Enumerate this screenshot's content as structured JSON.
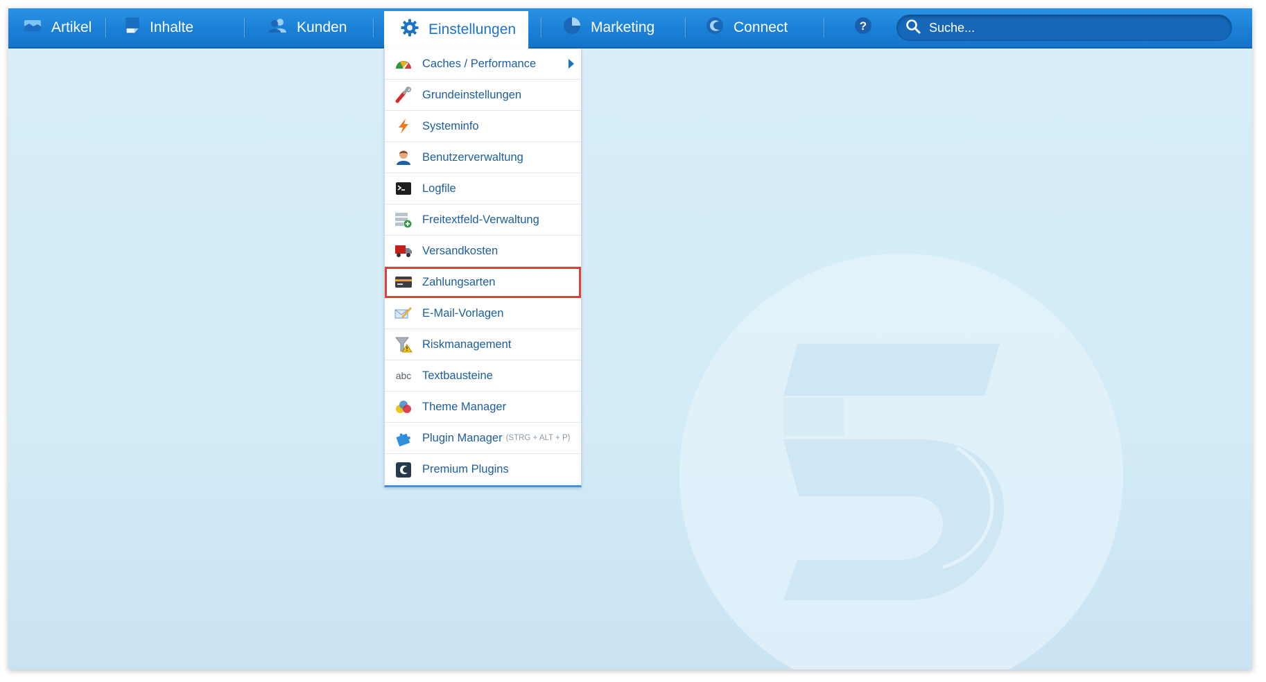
{
  "nav": {
    "items": [
      {
        "label": "Artikel",
        "icon": "articles-icon"
      },
      {
        "label": "Inhalte",
        "icon": "content-icon"
      },
      {
        "label": "Kunden",
        "icon": "customers-icon"
      },
      {
        "label": "Einstellungen",
        "icon": "gear-icon",
        "active": true
      },
      {
        "label": "Marketing",
        "icon": "pie-chart-icon"
      },
      {
        "label": "Connect",
        "icon": "shopware-logo-icon"
      }
    ],
    "help_icon": "help-icon",
    "search": {
      "placeholder": "Suche...",
      "value": "",
      "icon": "search-icon"
    }
  },
  "menu": {
    "items": [
      {
        "label": "Caches / Performance",
        "icon": "speedometer-icon",
        "has_submenu": true
      },
      {
        "label": "Grundeinstellungen",
        "icon": "wrench-icon"
      },
      {
        "label": "Systeminfo",
        "icon": "lightning-icon"
      },
      {
        "label": "Benutzerverwaltung",
        "icon": "user-icon"
      },
      {
        "label": "Logfile",
        "icon": "terminal-icon"
      },
      {
        "label": "Freitextfeld-Verwaltung",
        "icon": "add-field-icon"
      },
      {
        "label": "Versandkosten",
        "icon": "truck-icon"
      },
      {
        "label": "Zahlungsarten",
        "icon": "credit-card-icon",
        "highlighted": true
      },
      {
        "label": "E-Mail-Vorlagen",
        "icon": "email-template-icon"
      },
      {
        "label": "Riskmanagement",
        "icon": "filter-warning-icon"
      },
      {
        "label": "Textbausteine",
        "icon": "abc-icon",
        "icon_text": "abc"
      },
      {
        "label": "Theme Manager",
        "icon": "theme-color-drops-icon"
      },
      {
        "label": "Plugin Manager",
        "icon": "puzzle-icon",
        "shortcut": "(STRG + ALT + P)"
      },
      {
        "label": "Premium Plugins",
        "icon": "premium-plugins-icon"
      }
    ]
  },
  "colors": {
    "nav_blue": "#1a80d6",
    "menu_text": "#1c5e9c",
    "highlight_border": "#e0403a",
    "background": "#d3ecf7"
  }
}
